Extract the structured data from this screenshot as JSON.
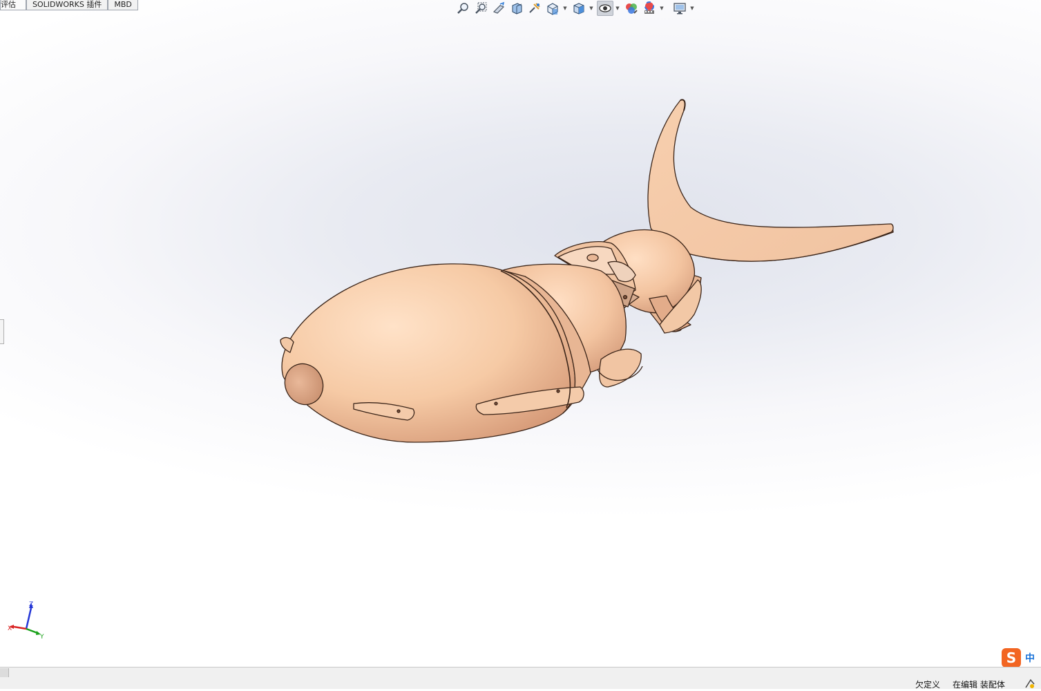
{
  "tabs": [
    {
      "label": "评估",
      "partial": true
    },
    {
      "label": "SOLIDWORKS 插件"
    },
    {
      "label": "MBD"
    }
  ],
  "hud_icons": [
    "zoom-to-fit-icon",
    "zoom-to-area-icon",
    "previous-view-icon",
    "section-view-icon",
    "dynamic-annotation-icon",
    "view-orientation-icon",
    "display-style-icon",
    "hide-show-items-icon",
    "edit-appearance-icon",
    "apply-scene-icon",
    "view-setting-icon"
  ],
  "triad": {
    "x": "X",
    "y": "Y",
    "z": "Z"
  },
  "ime": {
    "logo": "S",
    "mode": "中"
  },
  "status": {
    "definition": "欠定义",
    "editing": "在编辑 装配体"
  },
  "colors": {
    "model_fill": "#f2c9a8",
    "model_edge": "#3a2418",
    "viewport_bg": "#e6e8f0",
    "ime_orange": "#f26522"
  }
}
